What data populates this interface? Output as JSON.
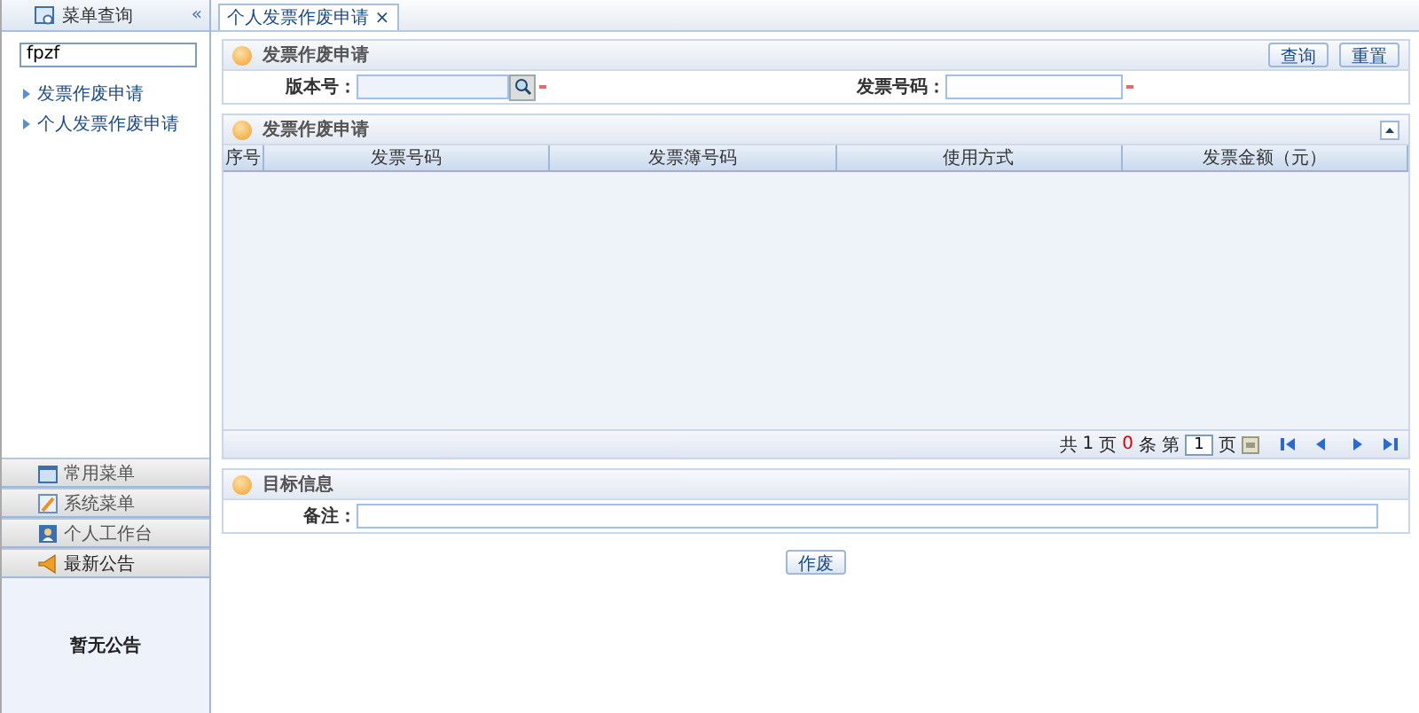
{
  "sidebar": {
    "title": "菜单查询",
    "collapse": "«",
    "search": {
      "value": "fpzf"
    },
    "tree": [
      {
        "label": "发票作废申请"
      },
      {
        "label": "个人发票作废申请"
      }
    ],
    "sections": [
      {
        "label": "常用菜单",
        "kind": "menu"
      },
      {
        "label": "系统菜单",
        "kind": "system"
      },
      {
        "label": "个人工作台",
        "kind": "desk"
      },
      {
        "label": "最新公告",
        "kind": "notice"
      }
    ],
    "notice": "暂无公告"
  },
  "tabs": [
    {
      "label": "个人发票作废申请",
      "close": "×",
      "selected": true
    }
  ],
  "query_panel": {
    "title": "发票作废申请",
    "buttons": [
      "查询",
      "重置"
    ],
    "fields": [
      {
        "label": "版本号：",
        "lookup": true,
        "required": true
      },
      {
        "label": "发票号码：",
        "lookup": false,
        "required": true
      }
    ]
  },
  "table_panel": {
    "title": "发票作废申请",
    "columns": [
      "序号",
      "发票号码",
      "发票簿号码",
      "使用方式",
      "发票金额（元）"
    ],
    "pager": {
      "total_prefix": "共",
      "pages": "1",
      "pages_unit": "页",
      "records": "0",
      "records_unit": "条",
      "page_prefix": "第",
      "page_value": "1",
      "page_suffix": "页"
    }
  },
  "target_panel": {
    "title": "目标信息",
    "fields": [
      {
        "label": "备注："
      }
    ]
  },
  "action_button": "作废"
}
